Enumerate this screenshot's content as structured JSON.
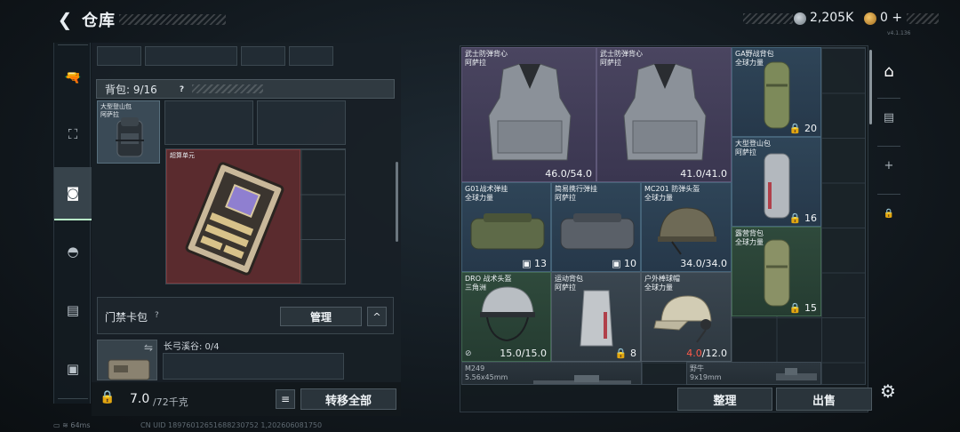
{
  "header": {
    "back_icon": "back-arrow-icon",
    "title": "仓库",
    "currency_silver": "2,205K",
    "currency_gold": "0",
    "plus": "+",
    "version": "v4.1.136"
  },
  "leftnav": {
    "items": [
      {
        "icon": "pistol-icon",
        "glyph": "🔫"
      },
      {
        "icon": "vest-icon",
        "glyph": "⛶"
      },
      {
        "icon": "backpack-active-icon",
        "glyph": "◙"
      },
      {
        "icon": "helmet-icon",
        "glyph": "◓"
      },
      {
        "icon": "clipboard-icon",
        "glyph": "▤"
      },
      {
        "icon": "toolbox-icon",
        "glyph": "▣"
      }
    ]
  },
  "backpack": {
    "label": "背包: 9/16",
    "help": "?",
    "equipped_name": "大型登山包\n阿萨拉",
    "chip_name": "超算单元"
  },
  "keycard": {
    "label": "门禁卡包",
    "help": "?",
    "manage": "管理",
    "collapse": "^"
  },
  "lhs": {
    "label": "长弓溪谷: 0/4",
    "swap_icon": "⇋"
  },
  "bottom_left": {
    "weight": "7.0",
    "weight_max": "/72千克",
    "list_icon": "≡",
    "transfer_all": "转移全部"
  },
  "storage": {
    "items": [
      {
        "name": "武士防弹背心\n阿萨拉",
        "stat": "46.0/54.0",
        "stat_red": ""
      },
      {
        "name": "武士防弹背心\n阿萨拉",
        "stat": "41.0/41.0",
        "stat_red": ""
      },
      {
        "name": "GA野战背包\n全球力量",
        "count": "20"
      },
      {
        "name": "大型登山包\n阿萨拉",
        "count": "16"
      },
      {
        "name": "G01战术弹挂\n全球力量",
        "count": "13"
      },
      {
        "name": "简易携行弹挂\n阿萨拉",
        "count": "10"
      },
      {
        "name": "MC201 防弹头盔\n全球力量",
        "stat": "34.0/34.0",
        "stat_red": ""
      },
      {
        "name": "露营背包\n全球力量",
        "count": "15"
      },
      {
        "name": "DRO 战术头盔\n三角洲",
        "stat": "15.0/15.0",
        "stat_red": ""
      },
      {
        "name": "运动背包\n阿萨拉",
        "count": "8"
      },
      {
        "name": "户外棒球帽\n全球力量",
        "stat": "/12.0",
        "stat_red": "4.0"
      },
      {
        "name": "M249\n5.56x45mm"
      },
      {
        "name": "野牛\n9x19mm"
      }
    ]
  },
  "rightnav": {
    "items": [
      {
        "icon": "storage-active-icon",
        "glyph": "⌂"
      },
      {
        "icon": "records-icon",
        "glyph": "▤"
      },
      {
        "icon": "add-icon",
        "glyph": "+"
      },
      {
        "icon": "lock-icon",
        "glyph": "🔒"
      }
    ]
  },
  "actions": {
    "sort": "整理",
    "sell": "出售",
    "settings_icon": "⚙"
  },
  "status": {
    "signal": "64ms",
    "uid": "CN UID 18976012651688230752 1,202606081750"
  }
}
